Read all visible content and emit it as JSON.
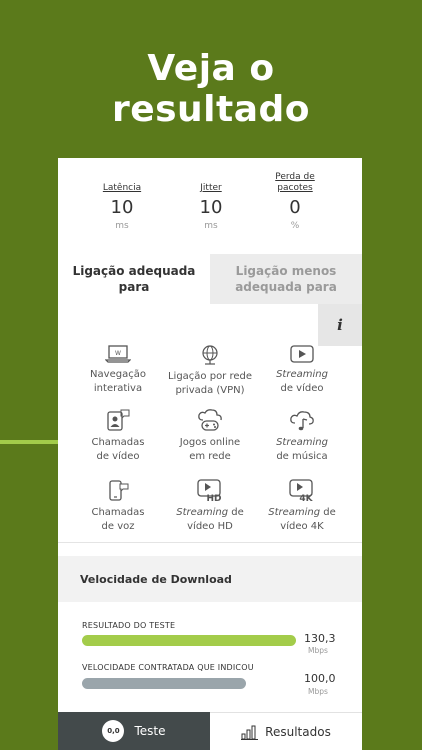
{
  "headline": {
    "line1": "Veja o",
    "line2": "resultado"
  },
  "metrics": [
    {
      "label": "Latência",
      "value": "10",
      "unit": "ms"
    },
    {
      "label": "Jitter",
      "value": "10",
      "unit": "ms"
    },
    {
      "label": "Perda de pacotes",
      "value": "0",
      "unit": "%"
    }
  ],
  "tabs": {
    "active": "Ligação adequada para",
    "inactive": "Ligação menos adequada para"
  },
  "info_button": "i",
  "services": [
    {
      "l1": "Navegação",
      "l2": "interativa"
    },
    {
      "l1": "Ligação por rede",
      "l2": "privada (VPN)"
    },
    {
      "l1": "Streaming",
      "l2": "de vídeo"
    },
    {
      "l1": "Chamadas",
      "l2": "de vídeo"
    },
    {
      "l1": "Jogos online",
      "l2": "em rede"
    },
    {
      "l1": "Streaming",
      "l2": "de música"
    },
    {
      "l1": "Chamadas",
      "l2": "de voz"
    },
    {
      "l1a": "Streaming",
      "l1b": " de",
      "l2": "vídeo HD"
    },
    {
      "l1a": "Streaming",
      "l1b": " de",
      "l2": "vídeo 4K"
    }
  ],
  "download": {
    "title": "Velocidade de Download",
    "test_label": "RESULTADO DO TESTE",
    "test_value": "130,3",
    "test_unit": "Mbps",
    "test_fraction": 1.0,
    "contract_label": "VELOCIDADE CONTRATADA QUE INDICOU",
    "contract_value": "100,0",
    "contract_unit": "Mbps",
    "contract_fraction": 0.767
  },
  "nav": {
    "badge": "0,0",
    "test": "Teste",
    "results": "Resultados"
  },
  "colors": {
    "background": "#5b7a1b",
    "accent": "#a3cc4a",
    "bar_contract": "#9aa5ab",
    "nav_dark": "#434a4b"
  }
}
